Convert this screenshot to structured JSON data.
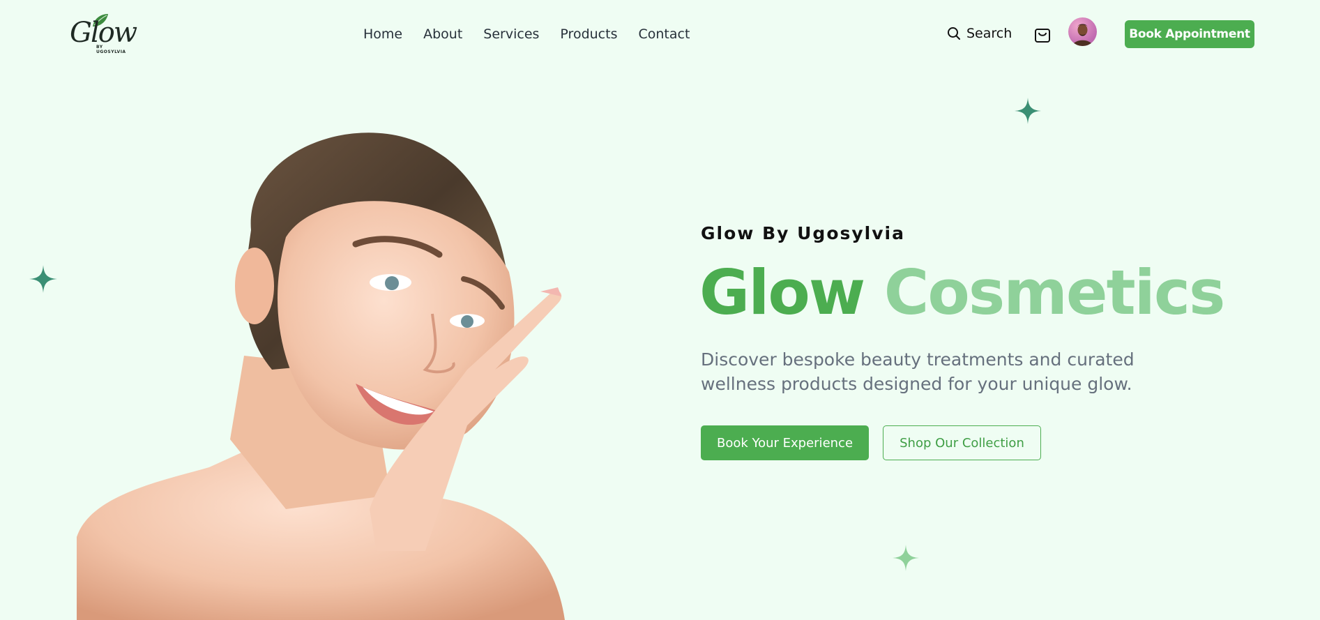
{
  "brand": {
    "logo_text": "Glow",
    "logo_subtext": "BY UGOSYLVIA"
  },
  "nav": {
    "items": [
      "Home",
      "About",
      "Services",
      "Products",
      "Contact"
    ]
  },
  "header": {
    "search_label": "Search",
    "book_button": "Book Appointment"
  },
  "hero": {
    "eyebrow": "Glow By Ugosylvia",
    "headline_word1": "Glow",
    "headline_word2": "Cosmetics",
    "description": "Discover bespoke beauty treatments and curated wellness products designed for your unique glow.",
    "primary_cta": "Book Your Experience",
    "secondary_cta": "Shop Our Collection"
  },
  "icons": {
    "search": "search-icon",
    "cart": "shopping-bag-icon",
    "sparkle": "sparkle-icon"
  },
  "colors": {
    "background": "#effdf3",
    "primary_green": "#4cad50",
    "light_green": "#8fd19a",
    "sparkle_teal": "#3b8f74",
    "text_muted": "#66707d"
  }
}
